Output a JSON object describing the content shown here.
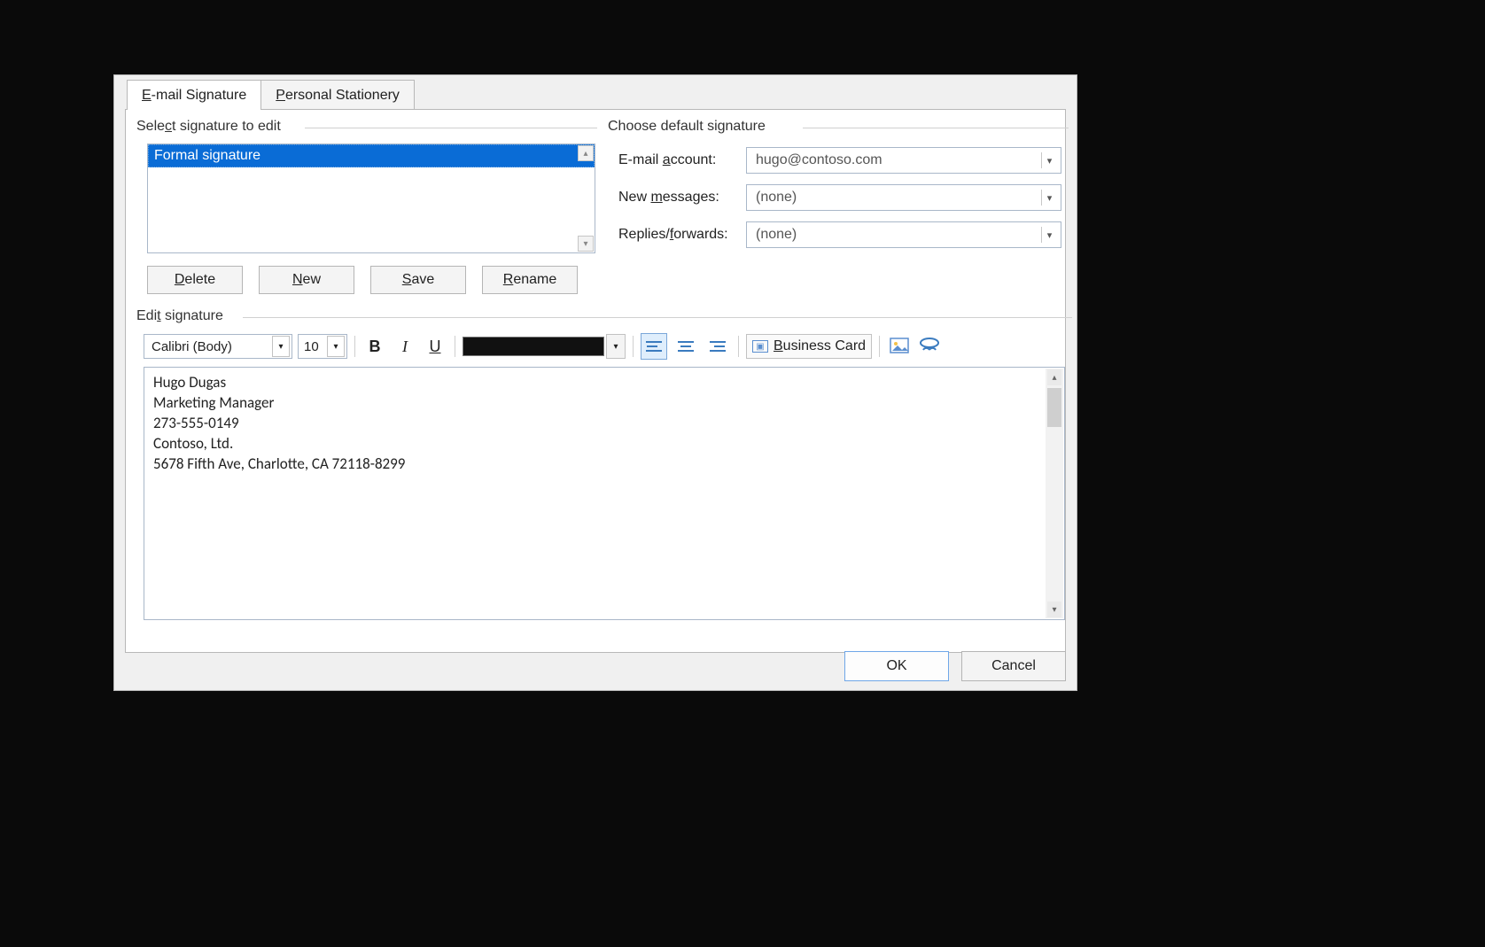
{
  "tabs": {
    "email_signature": "E-mail Signature",
    "personal_stationery": "Personal Stationery"
  },
  "select_group_label": "Select signature to edit",
  "signature_list": {
    "items": [
      "Formal signature"
    ],
    "selected_index": 0
  },
  "buttons": {
    "delete": "Delete",
    "new": "New",
    "save": "Save",
    "rename": "Rename"
  },
  "defaults_group_label": "Choose default signature",
  "defaults": {
    "email_account_label": "E-mail account:",
    "email_account_value": "hugo@contoso.com",
    "new_messages_label": "New messages:",
    "new_messages_value": "(none)",
    "replies_forwards_label": "Replies/forwards:",
    "replies_forwards_value": "(none)"
  },
  "edit_group_label": "Edit signature",
  "toolbar": {
    "font_name": "Calibri (Body)",
    "font_size": "10",
    "color": "#000000",
    "business_card_label": "Business Card"
  },
  "editor": {
    "lines": [
      "Hugo Dugas",
      "Marketing Manager",
      "273-555-0149",
      "Contoso, Ltd.",
      "5678 Fifth Ave, Charlotte, CA 72118-8299"
    ]
  },
  "dialog_buttons": {
    "ok": "OK",
    "cancel": "Cancel"
  }
}
